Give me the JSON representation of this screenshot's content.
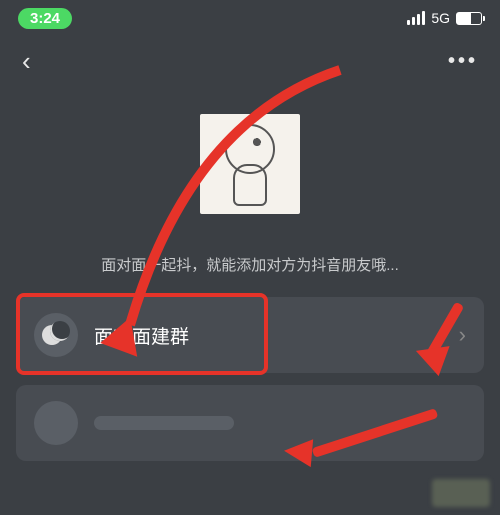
{
  "status": {
    "time": "3:24",
    "network_label": "5G"
  },
  "nav": {
    "back_icon": "‹",
    "more_icon": "•••"
  },
  "hero": {
    "subtitle": "面对面一起抖，就能添加对方为抖音朋友哦..."
  },
  "list": {
    "primary": {
      "icon": "face-to-face-icon",
      "label": "面对面建群",
      "chevron": "›"
    }
  },
  "colors": {
    "accent_red": "#e63329",
    "bg": "#3b3f44",
    "card": "#484c52"
  }
}
